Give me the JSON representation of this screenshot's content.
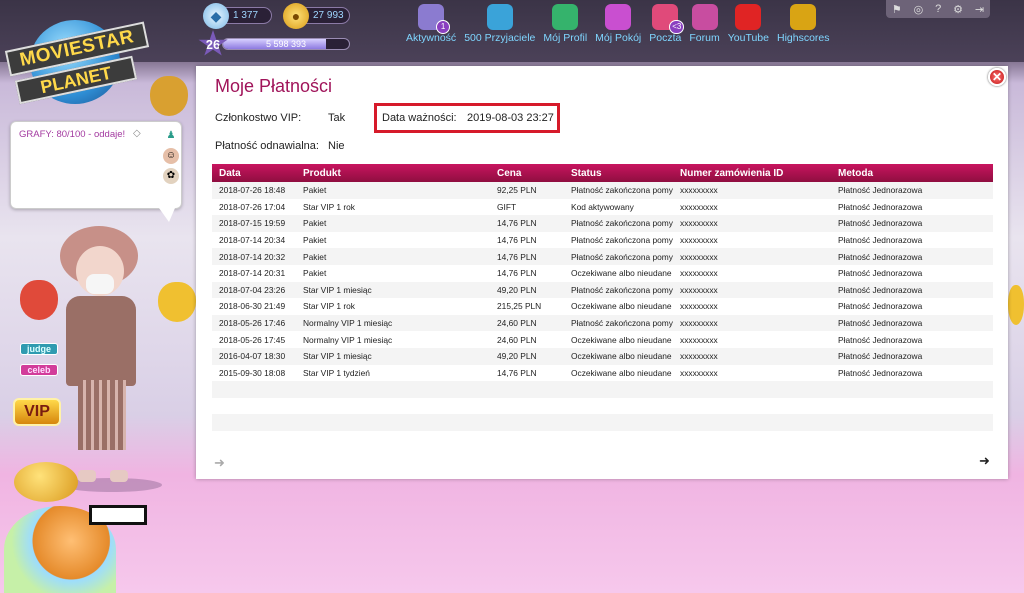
{
  "topbar": {
    "diamonds": "1 377",
    "coins": "27 993",
    "level": "26",
    "fame": "5 598 393",
    "fame_fraction": 0.82,
    "nav": [
      {
        "label": "Aktywność",
        "icon": "activity-icon",
        "color": "#8b7bd0",
        "badge": "1"
      },
      {
        "label": "500 Przyjaciele",
        "icon": "friends-icon",
        "color": "#3aa3d9"
      },
      {
        "label": "Mój Profil",
        "icon": "profile-icon",
        "color": "#35b36c"
      },
      {
        "label": "Mój Pokój",
        "icon": "room-icon",
        "color": "#c94fd0"
      },
      {
        "label": "Poczta",
        "icon": "mail-icon",
        "color": "#e04a7a",
        "badge": "<3"
      },
      {
        "label": "Forum",
        "icon": "forum-icon",
        "color": "#c84da0"
      },
      {
        "label": "YouTube",
        "icon": "youtube-icon",
        "color": "#e02424"
      },
      {
        "label": "Highscores",
        "icon": "trophy-icon",
        "color": "#d9a414"
      }
    ]
  },
  "logo": {
    "line1": "MOVIESTAR",
    "line2": "PLANET"
  },
  "status_bubble": {
    "text": "GRAFY: 80/100 - oddaje!"
  },
  "side_tags": {
    "judge": "judge",
    "celeb": "celeb",
    "vip": "VIP"
  },
  "panel": {
    "title": "Moje Płatności",
    "vip_label": "Członkostwo VIP:",
    "vip_value": "Tak",
    "expiry_label": "Data ważności:",
    "expiry_value": "2019-08-03 23:27",
    "renew_label": "Płatność odnawialna:",
    "renew_value": "Nie",
    "columns": [
      "Data",
      "Produkt",
      "Cena",
      "Status",
      "Numer zamówienia ID",
      "Metoda"
    ],
    "rows": [
      [
        "2018-07-26 18:48",
        "Pakiet",
        "92,25 PLN",
        "Płatność zakończona pomy",
        "xxxxxxxxx",
        "Płatność Jednorazowa"
      ],
      [
        "2018-07-26 17:04",
        "Star VIP 1 rok",
        "GIFT",
        "Kod aktywowany",
        "xxxxxxxxx",
        "Płatność Jednorazowa"
      ],
      [
        "2018-07-15 19:59",
        "Pakiet",
        "14,76 PLN",
        "Płatność zakończona pomy",
        "xxxxxxxxx",
        "Płatność Jednorazowa"
      ],
      [
        "2018-07-14 20:34",
        "Pakiet",
        "14,76 PLN",
        "Płatność zakończona pomy",
        "xxxxxxxxx",
        "Płatność Jednorazowa"
      ],
      [
        "2018-07-14 20:32",
        "Pakiet",
        "14,76 PLN",
        "Płatność zakończona pomy",
        "xxxxxxxxx",
        "Płatność Jednorazowa"
      ],
      [
        "2018-07-14 20:31",
        "Pakiet",
        "14,76 PLN",
        "Oczekiwane albo nieudane",
        "xxxxxxxxx",
        "Płatność Jednorazowa"
      ],
      [
        "2018-07-04 23:26",
        "Star VIP 1 miesiąc",
        "49,20 PLN",
        "Płatność zakończona pomy",
        "xxxxxxxxx",
        "Płatność Jednorazowa"
      ],
      [
        "2018-06-30 21:49",
        "Star VIP 1 rok",
        "215,25 PLN",
        "Oczekiwane albo nieudane",
        "xxxxxxxxx",
        "Płatność Jednorazowa"
      ],
      [
        "2018-05-26 17:46",
        "Normalny VIP 1 miesiąc",
        "24,60 PLN",
        "Płatność zakończona pomy",
        "xxxxxxxxx",
        "Płatność Jednorazowa"
      ],
      [
        "2018-05-26 17:45",
        "Normalny VIP 1 miesiąc",
        "24,60 PLN",
        "Oczekiwane albo nieudane",
        "xxxxxxxxx",
        "Płatność Jednorazowa"
      ],
      [
        "2016-04-07 18:30",
        "Star VIP 1 miesiąc",
        "49,20 PLN",
        "Oczekiwane albo nieudane",
        "xxxxxxxxx",
        "Płatność Jednorazowa"
      ],
      [
        "2015-09-30 18:08",
        "Star VIP 1 tydzień",
        "14,76 PLN",
        "Oczekiwane albo nieudane",
        "xxxxxxxxx",
        "Płatność Jednorazowa"
      ]
    ],
    "empty_rows": 3
  },
  "colors": {
    "accent": "#a0145a",
    "header_bar": "#c8145f",
    "highlight_box": "#d61a2a"
  }
}
